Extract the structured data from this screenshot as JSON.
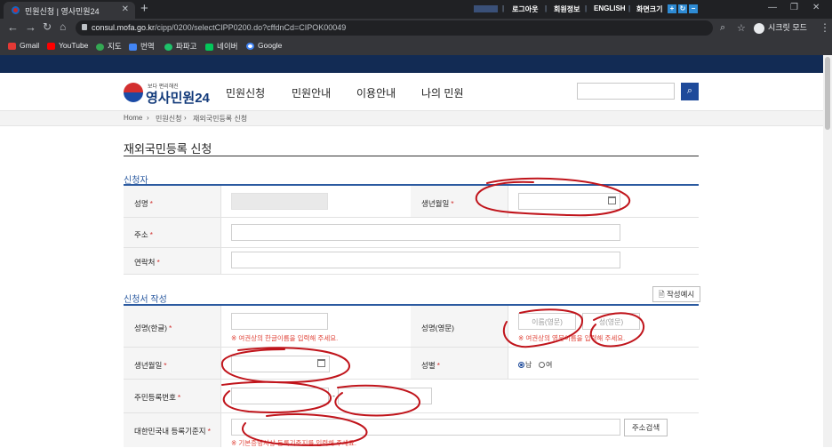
{
  "browser": {
    "tab_title": "민원신청 | 영사민원24",
    "tab_close": "✕",
    "new_tab": "+",
    "url_host": "consul.mofa.go.kr",
    "url_path": "/cipp/0200/selectCIPP0200.do?cffdnCd=CIPOK00049",
    "profile_label": "시크릿 모드",
    "bookmarks": [
      "Gmail",
      "YouTube",
      "지도",
      "번역",
      "파파고",
      "네이버",
      "Google"
    ]
  },
  "util_links": [
    "로그아웃",
    "회원정보",
    "ENGLISH",
    "화면크기"
  ],
  "font_size_buttons": [
    "+",
    "↻",
    "−"
  ],
  "site": {
    "logo_sub": "보다 편리해진",
    "logo_main": "영사민원24",
    "nav": [
      "민원신청",
      "민원안내",
      "이용안내",
      "나의 민원"
    ],
    "search_icon": "search-icon"
  },
  "breadcrumb": [
    "Home",
    "민원신청",
    "재외국민등록 신청"
  ],
  "page_title": "재외국민등록 신청",
  "applicant": {
    "title": "신청자",
    "name_label": "성명",
    "birth_label": "생년월일",
    "address_label": "주소",
    "contact_label": "연락처"
  },
  "form": {
    "title": "신청서 작성",
    "example_button": "작성예시",
    "name_kr_label": "성명(한글)",
    "name_kr_hint": "※ 여권상의 한글이름을 입력해 주세요.",
    "name_en_label": "성명(영문)",
    "given_name_placeholder": "이름(영문)",
    "surname_placeholder": "성(영문)",
    "name_en_hint": "※ 여권상의 영문이름을 입력해 주세요.",
    "birth_label": "생년월일",
    "gender_label": "성별",
    "gender_male": "남",
    "gender_female": "여",
    "rrn_label": "주민등록번호",
    "rrn_sep": "-",
    "domicile_label": "대한민국내 등록기준지",
    "address_search_button": "주소검색",
    "domicile_hint": "※ 기본증명서상 등록기준지를 입력해 주세요."
  },
  "required_mark": "*",
  "colors": {
    "brand_navy": "#122b54",
    "accent_blue": "#2b5aa0",
    "required_red": "#d0302f",
    "annotation_red": "#c0141b"
  }
}
